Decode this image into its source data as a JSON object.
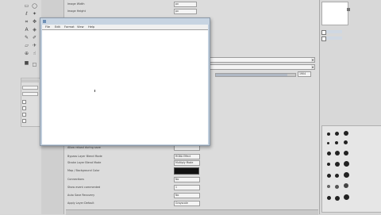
{
  "notepad": {
    "menu": [
      "File",
      "Edit",
      "Format",
      "View",
      "Help"
    ]
  },
  "props": {
    "top_rows": [
      {
        "label": "Image Width",
        "value": "px"
      },
      {
        "label": "Image Height",
        "value": "px"
      }
    ],
    "percent_value": "1904",
    "bottom_rows": [
      {
        "label": "Allow reload during save",
        "value": ""
      },
      {
        "label": "Bypass Layer Blend Mode",
        "value": "RGBA Effect"
      },
      {
        "label": "Stroke Layer Blend Mode",
        "value": "Multiply Mode"
      },
      {
        "label": "Map / Background Color",
        "value": ""
      },
      {
        "label": "Connections",
        "value": "No"
      },
      {
        "label": "Show event commented",
        "value": "1"
      },
      {
        "label": "Auto Save Recovery",
        "value": "No"
      },
      {
        "label": "Apply Layer Default",
        "value": "Grayscale"
      }
    ]
  },
  "colors": {
    "swatch": "#111111"
  }
}
